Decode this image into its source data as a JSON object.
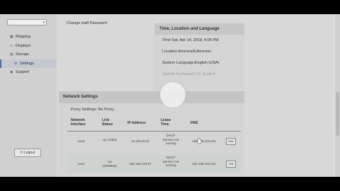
{
  "sidebar": {
    "select_value": "",
    "items": [
      {
        "label": "Mapping",
        "icon": "grid-icon"
      },
      {
        "label": "Displays",
        "icon": "display-icon"
      },
      {
        "label": "Storage",
        "icon": "storage-icon"
      },
      {
        "label": "Settings",
        "icon": "gear-icon"
      },
      {
        "label": "Support",
        "icon": "support-icon"
      }
    ],
    "logout_label": "Logout"
  },
  "main": {
    "change_password_label": "Change staff Password",
    "time_panel": {
      "title": "Time, Location and Language",
      "time": "Time:Sat, Apr 14, 2018, 4:06 PM",
      "location": "Location:America/Edmonton",
      "language": "System Language:English (USA)",
      "keyboard": "System Keyboard:U.S. English"
    },
    "network": {
      "title": "Network Settings",
      "proxy": "Proxy Settings: No Proxy",
      "headers": [
        "Network Interface",
        "Link Status",
        "IP Address",
        "Lease Time",
        "DNS"
      ],
      "rows": [
        {
          "iface": "eno1",
          "link": "Up 1Gbps",
          "ip": "10.100.20.31",
          "lease": "DHCP Service not running",
          "dns": "192.168.123.224",
          "edit": "Edit"
        },
        {
          "iface": "eno1",
          "link": "Up 1000Mbps",
          "ip": "192.168.123.87",
          "lease": "DHCP Service not running",
          "dns": "192.168.123.224",
          "edit": "Edit"
        }
      ]
    }
  }
}
